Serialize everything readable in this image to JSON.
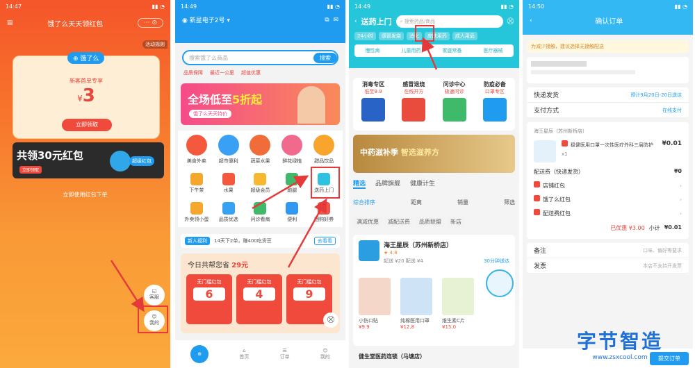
{
  "watermark": {
    "title": "字节智造",
    "url": "www.zsxcool.com"
  },
  "panel1": {
    "time": "14:47",
    "title": "饿了么天天领红包",
    "tag": "活动规则",
    "brand": "饿了么",
    "sub": "新客首单专享",
    "amount": "3",
    "currency": "¥",
    "coupon_btn": "立即领取",
    "banner_text": "共领30元红包",
    "banner_small": "立即领取",
    "banner_btn": "超级红包",
    "use_link": "立即使用红包下单",
    "side_btn1": "客服",
    "side_btn2": "我的"
  },
  "panel2": {
    "time": "14:49",
    "location": "新星电子2号",
    "search_placeholder": "搜索饿了么商品",
    "search_btn": "搜索",
    "tags": [
      "品质保障",
      "最近一公里",
      "超值优惠"
    ],
    "promo_title": "全场低至",
    "promo_highlight": "5折起",
    "promo_sub": "饿了么天天特价",
    "grid": [
      {
        "label": "美食外卖",
        "color": "#f5593d"
      },
      {
        "label": "超市便利",
        "color": "#3aa0f3"
      },
      {
        "label": "蔬菜水果",
        "color": "#f06d3a"
      },
      {
        "label": "鲜花绿植",
        "color": "#f2698e"
      },
      {
        "label": "甜品饮品",
        "color": "#f7a52c"
      }
    ],
    "grid2": [
      {
        "label": "下午茶",
        "color": "#f5a72d"
      },
      {
        "label": "水果",
        "color": "#f4593d"
      },
      {
        "label": "超级会员",
        "color": "#f7b731"
      },
      {
        "label": "跑腿",
        "color": "#3fb96a"
      },
      {
        "label": "送药上门",
        "color": "#2fc1e0"
      }
    ],
    "grid3": [
      {
        "label": "外卖领小蛋",
        "color": "#f5a72d"
      },
      {
        "label": "品质优选",
        "color": "#37a2f2"
      },
      {
        "label": "问诊看病",
        "color": "#3fb96a"
      },
      {
        "label": "便利",
        "color": "#2f9af0"
      },
      {
        "label": "团购好券",
        "color": "#f0554a"
      }
    ],
    "notice_tag": "新人福利",
    "notice_text": "14天下2单，赚400吃货豆",
    "notice_btn": "去看看",
    "savings_title": "今日共帮您省",
    "savings_amount": "29元",
    "coupons": [
      "6",
      "4",
      "9"
    ],
    "coupon_label": "无门槛红包",
    "nav": [
      "首页",
      "",
      "订单",
      "我的"
    ]
  },
  "panel3": {
    "time": "14:49",
    "title": "送药上门",
    "search_placeholder": "搜索药品/商品",
    "tabs": [
      "24小时",
      "感冒发烧",
      "消化",
      "皮肤用药",
      "成人用品"
    ],
    "categories": [
      "慢性病",
      "儿童用药",
      "家庭常备",
      "医疗器械"
    ],
    "products_row": [
      {
        "title": "消毒专区",
        "sub": "低至9.9"
      },
      {
        "title": "感冒退烧",
        "sub": "在线开方"
      },
      {
        "title": "问诊中心",
        "sub": "极速问诊"
      },
      {
        "title": "防疫必备",
        "sub": "口罩专区"
      }
    ],
    "banner_main": "中药滋补季",
    "banner_highlight": "智选滋养方",
    "tabs2": [
      "精选",
      "品牌旗舰",
      "健康计生"
    ],
    "filters": [
      "综合排序",
      "距离",
      "销量",
      "筛选"
    ],
    "chips": [
      "满减优惠",
      "减配送费",
      "品质联盟",
      "新店"
    ],
    "store_name": "海王星辰（苏州新桥店）",
    "store_rating": "4.8",
    "store_info": "起送 ¥20 配送 ¥4",
    "store_action": "30分钟送达",
    "items": [
      {
        "name": "小伤口贴",
        "price": "¥9.9"
      },
      {
        "name": "纯棉医用口罩",
        "price": "¥12.8"
      },
      {
        "name": "维生素C片",
        "price": "¥15.0"
      }
    ],
    "next_store": "健生堂医药连锁（马塘店）"
  },
  "panel4": {
    "time": "14:50",
    "title": "确认订单",
    "notice": "为减少接触，建议选择无接触配送",
    "delivery_label": "快递发货",
    "delivery_value": "预计9月20日-20日送达",
    "payment_label": "支付方式",
    "payment_value": "在线支付",
    "store_line": "海王星辰（苏州新桥店）",
    "product_name": "稳健医用口罩一次性医疗外科三层防护",
    "product_price": "¥0.01",
    "product_qty": "x1",
    "shipping_label": "配送费（快递发货）",
    "shipping_value": "¥0",
    "discounts": [
      {
        "label": "店铺红包",
        "value": ""
      },
      {
        "label": "饿了么红包",
        "value": ""
      },
      {
        "label": "配送费红包",
        "value": ""
      }
    ],
    "summary_label": "已优惠 ¥3.00",
    "total_label": "小计",
    "total_value": "¥0.01",
    "remark_label": "备注",
    "remark_value": "口味、偏好等要求",
    "invoice_label": "发票",
    "invoice_value": "本店不支持开发票",
    "submit": "提交订单"
  }
}
